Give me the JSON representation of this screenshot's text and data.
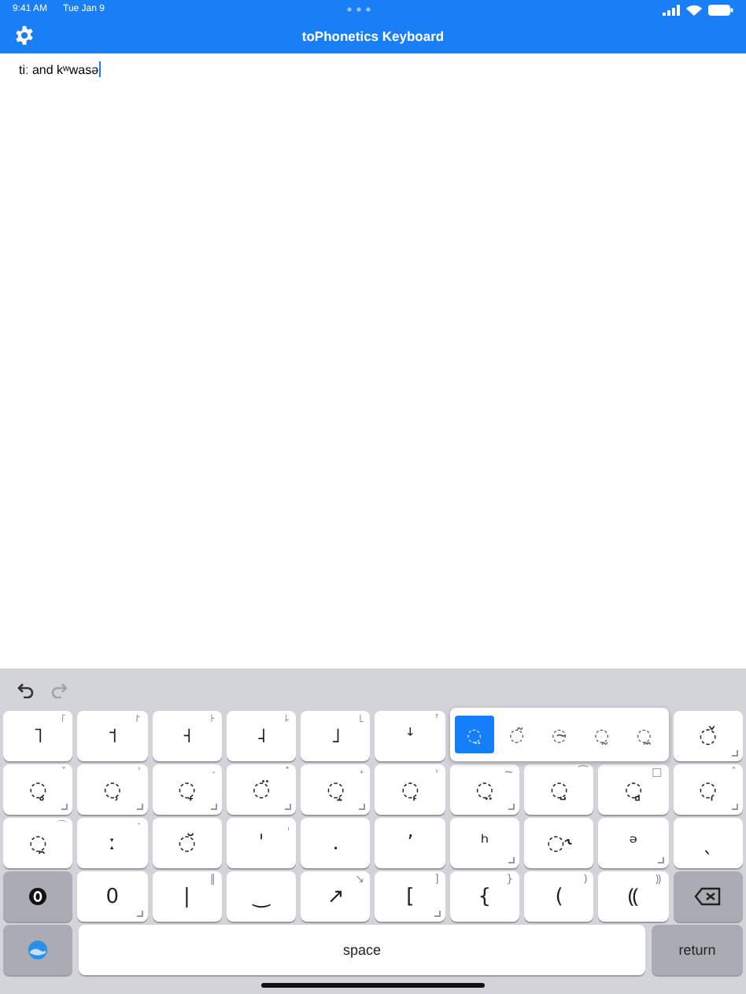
{
  "status_bar": {
    "time": "9:41 AM",
    "date": "Tue Jan 9"
  },
  "nav": {
    "title": "toPhonetics Keyboard"
  },
  "editor": {
    "value": "tiː and kʷwasə"
  },
  "toolbar": {
    "undo_disabled": false,
    "redo_disabled": true
  },
  "keyboard": {
    "rows": [
      [
        {
          "kind": "symbol",
          "label": "˥",
          "hint": "꜒",
          "more": false
        },
        {
          "kind": "symbol",
          "label": "˦",
          "hint": "꜓",
          "more": false
        },
        {
          "kind": "symbol",
          "label": "˧",
          "hint": "꜔",
          "more": false
        },
        {
          "kind": "symbol",
          "label": "˨",
          "hint": "꜕",
          "more": false
        },
        {
          "kind": "symbol",
          "label": "˩",
          "hint": "꜖",
          "more": false
        },
        {
          "kind": "symbol",
          "label": "ꜜ",
          "hint": "ꜛ",
          "more": false
        },
        {
          "kind": "popup",
          "options": [
            {
              "label": "◌̤",
              "selected": true
            },
            {
              "label": "◌̃",
              "selected": false
            },
            {
              "label": "◌̴",
              "selected": false
            },
            {
              "label": "◌̰",
              "selected": false
            },
            {
              "label": "◌̼",
              "selected": false
            }
          ]
        },
        "",
        "",
        {
          "kind": "symbol",
          "label": "◌̌",
          "more": true
        }
      ],
      [
        {
          "kind": "symbol",
          "label": "◌̥",
          "hint": "ˇ",
          "more": true
        },
        {
          "kind": "symbol",
          "label": "◌̹",
          "hint": "ʾ",
          "more": true
        },
        {
          "kind": "symbol",
          "label": "◌̟",
          "hint": "˗",
          "more": true
        },
        {
          "kind": "symbol",
          "label": "◌̈",
          "hint": "˟",
          "more": true
        },
        {
          "kind": "symbol",
          "label": "◌̝",
          "hint": "˔",
          "more": true
        },
        {
          "kind": "symbol",
          "label": "◌̙",
          "hint": "˒",
          "more": false
        },
        {
          "kind": "symbol",
          "label": "◌̤",
          "hint": "~",
          "more": true
        },
        {
          "kind": "symbol",
          "label": "◌̺",
          "hint": "⁀",
          "more": false
        },
        {
          "kind": "symbol",
          "label": "◌̻",
          "hint": "□",
          "more": false
        },
        {
          "kind": "symbol",
          "label": "◌̩",
          "hint": "ˆ",
          "more": true
        }
      ],
      [
        {
          "kind": "symbol",
          "label": "◌̯",
          "hint": "⌒",
          "more": false
        },
        {
          "kind": "symbol",
          "label": "ː",
          "hint": "ˑ",
          "more": false
        },
        {
          "kind": "symbol",
          "label": "◌̆",
          "more": false
        },
        {
          "kind": "symbol",
          "label": "ˈ",
          "hint": "ˌ",
          "more": false
        },
        {
          "kind": "symbol",
          "label": ".",
          "more": false
        },
        {
          "kind": "symbol",
          "label": "ʼ",
          "more": false
        },
        {
          "kind": "symbol",
          "label": "ʰ",
          "more": true
        },
        {
          "kind": "symbol",
          "label": "◌˞",
          "more": false
        },
        {
          "kind": "symbol",
          "label": "ᵊ",
          "more": true
        },
        {
          "kind": "symbol",
          "label": "ˎ",
          "more": false
        }
      ],
      [
        {
          "kind": "mode"
        },
        {
          "kind": "symbol",
          "label": "0",
          "more": true
        },
        {
          "kind": "symbol",
          "label": "|",
          "hint": "‖",
          "more": false
        },
        {
          "kind": "symbol",
          "label": "‿",
          "more": false
        },
        {
          "kind": "symbol",
          "label": "↗",
          "hint": "↘",
          "more": false
        },
        {
          "kind": "symbol",
          "label": "[",
          "hint": "]",
          "more": true
        },
        {
          "kind": "symbol",
          "label": "{",
          "hint": "}",
          "more": false
        },
        {
          "kind": "symbol",
          "label": "(",
          "hint": ")",
          "more": false
        },
        {
          "kind": "symbol",
          "label": "⸨",
          "hint": "⸩",
          "more": false
        },
        {
          "kind": "delete"
        }
      ]
    ],
    "bottom_bar": [
      {
        "kind": "app"
      },
      {
        "kind": "space",
        "label": "space"
      },
      {
        "kind": "return",
        "label": "return"
      }
    ]
  }
}
